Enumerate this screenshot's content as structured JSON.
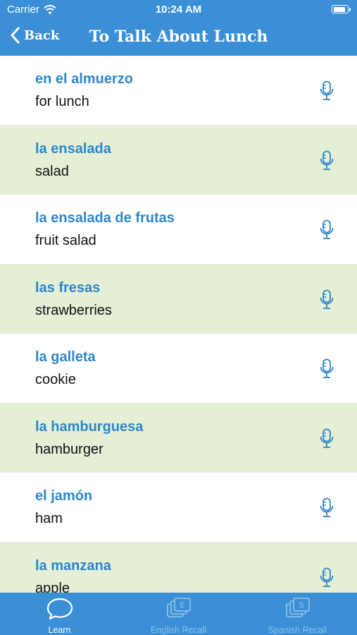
{
  "status_bar": {
    "carrier": "Carrier",
    "time": "10:24 AM",
    "battery_level": 0.9
  },
  "nav": {
    "back_label": "Back",
    "title": "To Talk About Lunch"
  },
  "items": [
    {
      "spanish": "en el almuerzo",
      "english": "for lunch"
    },
    {
      "spanish": "la ensalada",
      "english": "salad"
    },
    {
      "spanish": "la ensalada de frutas",
      "english": "fruit salad"
    },
    {
      "spanish": "las fresas",
      "english": "strawberries"
    },
    {
      "spanish": "la galleta",
      "english": "cookie"
    },
    {
      "spanish": "la hamburguesa",
      "english": "hamburger"
    },
    {
      "spanish": "el jamón",
      "english": "ham"
    },
    {
      "spanish": "la manzana",
      "english": "apple"
    }
  ],
  "tabs": [
    {
      "label": "Learn",
      "icon": "speech-bubble-icon",
      "active": true
    },
    {
      "label": "English Recall",
      "icon": "english-cards-icon",
      "card_letter": "E",
      "active": false
    },
    {
      "label": "Spanish Recall",
      "icon": "spanish-cards-icon",
      "card_letter": "S",
      "active": false
    }
  ],
  "colors": {
    "header": "#3a8fd6",
    "accent_text": "#2f86c9",
    "alt_row": "#e4efd6",
    "tab_inactive": "#8fbfe6"
  }
}
